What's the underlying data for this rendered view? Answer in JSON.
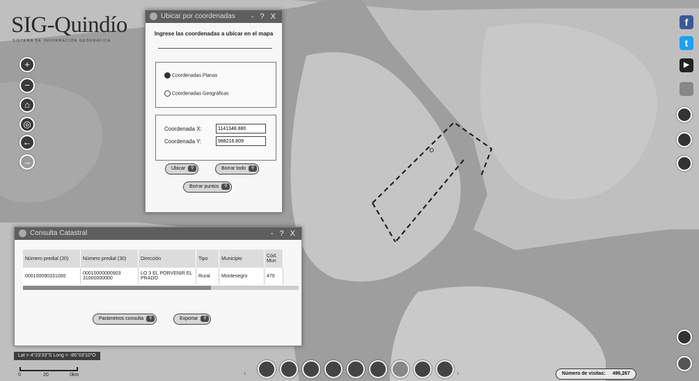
{
  "app": {
    "logo_title": "SIG-Quindío",
    "logo_subtitle": "SISTEMA DE INFORMACIÓN GEOGRÁFICA"
  },
  "map_controls": {
    "zoom_in": "+",
    "zoom_out": "−",
    "home": "⌂",
    "locate": "◎",
    "back": "←",
    "forward": "→"
  },
  "coord_panel": {
    "title": "Ubicar por coordenadas",
    "window_buttons": "- ? X",
    "instruction": "Ingrese las coordenadas a ubicar en el mapa",
    "radio_planas": "Coordenadas Planas",
    "radio_geograficas": "Coordenadas Geográficas",
    "selected_radio": "planas",
    "label_x": "Coordenada X:",
    "value_x": "1141348.880",
    "label_y": "Coordenada Y:",
    "value_y": "988216.809",
    "btn_ubicar": "Ubicar",
    "btn_borrar_todo": "Borrar todo",
    "btn_borrar_puntos": "Borrar puntos"
  },
  "cadastral_panel": {
    "title": "Consulta Catastral",
    "window_buttons": "- ? X",
    "columns": [
      "Número predial (20)",
      "Número predial (30)",
      "Dirección",
      "Tipo",
      "Municipio",
      "Cód. Mun"
    ],
    "rows": [
      [
        "000100090331000",
        "00010000000903 31000000000",
        "LO 3 EL PORVENIR EL PRADO",
        "Rural",
        "Montenegro",
        "470"
      ]
    ],
    "btn_parametros": "Parámetros consulta",
    "btn_exportar": "Exportar"
  },
  "status": {
    "latlong": "Lat = 4°23'33\"S Long = -86°03'10\"O",
    "scale_labels": [
      "0",
      "20",
      "0km"
    ],
    "visits_label": "Número de visitas:",
    "visits_value": "496,267"
  },
  "social": {
    "facebook": "f",
    "twitter": "t",
    "youtube": "▶"
  },
  "colors": {
    "map_dark": "#9b9b9b",
    "map_light": "#c2c2c2",
    "panel_title": "#5e5e5e"
  }
}
